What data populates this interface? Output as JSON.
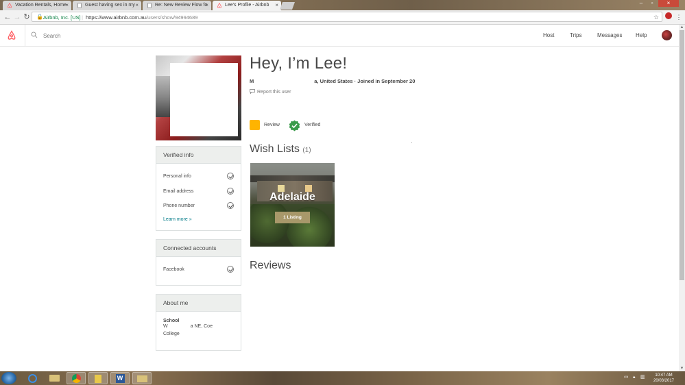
{
  "browser": {
    "tabs": [
      {
        "title": "Vacation Rentals, Home",
        "active": false
      },
      {
        "title": "Guest having sex in my",
        "active": false
      },
      {
        "title": "Re: New Review Flow fo",
        "active": false
      },
      {
        "title": "Lee's Profile - Airbnb",
        "active": true
      }
    ],
    "address": {
      "site": "Airbnb, Inc. [US]",
      "url_host": "https://www.airbnb.com.au",
      "url_path": "/users/show/94994689"
    }
  },
  "header": {
    "search_placeholder": "Search",
    "nav": [
      "Host",
      "Trips",
      "Messages",
      "Help"
    ]
  },
  "profile": {
    "greeting": "Hey, I’m Lee!",
    "location_prefix": "M",
    "location_suffix": "a, United States · Joined in September 20",
    "report_label": "Report this user",
    "badges": [
      {
        "label": "Review",
        "color": "#ffb400"
      },
      {
        "label": "Verified",
        "color": "#3a9b4a"
      }
    ]
  },
  "verified_info": {
    "title": "Verified info",
    "items": [
      "Personal info",
      "Email address",
      "Phone number"
    ],
    "learn_more": "Learn more »"
  },
  "connected_accounts": {
    "title": "Connected accounts",
    "items": [
      "Facebook"
    ]
  },
  "about_me": {
    "title": "About me",
    "school_label": "School",
    "school_line1": "W                 a NE, Coe",
    "school_line2": "College"
  },
  "wish_lists": {
    "title": "Wish Lists",
    "count": "(1)",
    "items": [
      {
        "name": "Adelaide",
        "listings": "1 Listing"
      }
    ]
  },
  "reviews": {
    "title": "Reviews"
  },
  "taskbar": {
    "time": "10:47 AM",
    "date": "20/03/2017"
  }
}
